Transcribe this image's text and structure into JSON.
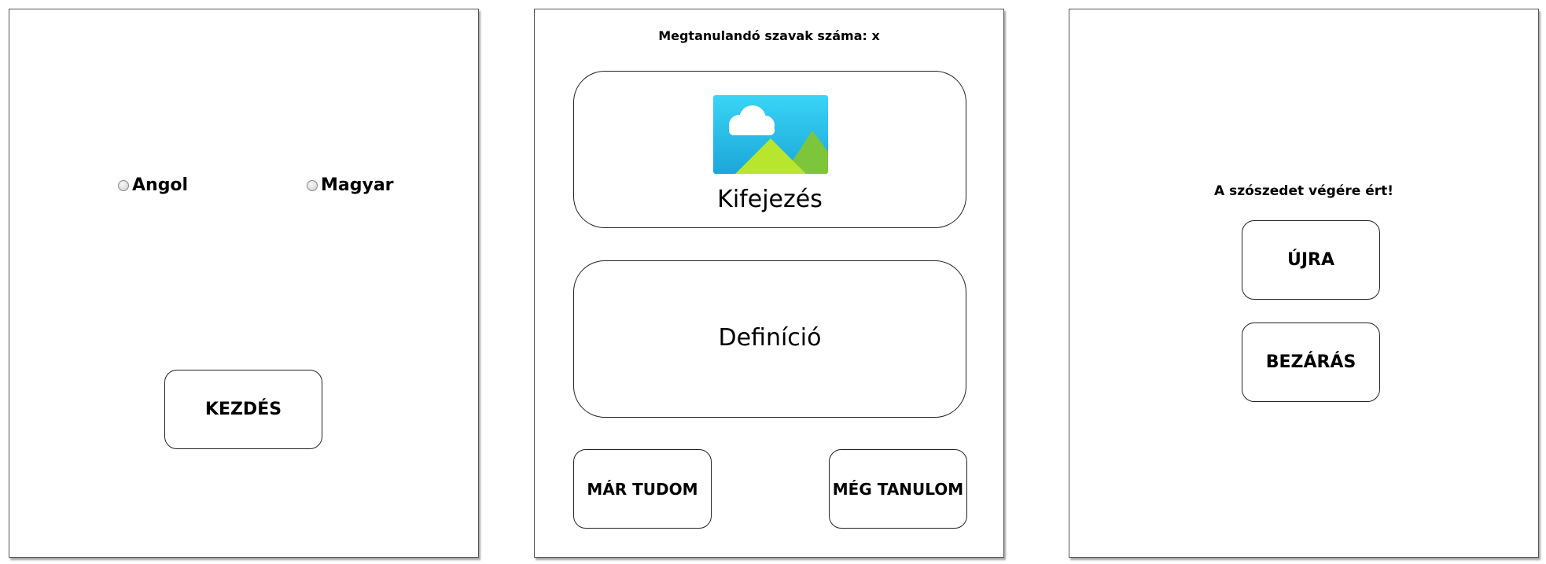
{
  "screen_start": {
    "radio_options": [
      "Angol",
      "Magyar"
    ],
    "start_button_label": "KEZDÉS"
  },
  "screen_learn": {
    "header_title": "Megtanulandó szavak száma: x",
    "expression_label": "Kifejezés",
    "image_icon": "image-placeholder-icon",
    "definition_label": "Definíció",
    "known_button_label": "MÁR TUDOM",
    "still_learning_button_label": "MÉG TANULOM"
  },
  "screen_end": {
    "message": "A szószedet végére ért!",
    "restart_button_label": "ÚJRA",
    "close_button_label": "BEZÁRÁS"
  },
  "colors": {
    "sky": "#2fc7ee",
    "cloud": "#ffffff",
    "hill_light": "#b8e62e",
    "hill_dark": "#7dc63b"
  }
}
